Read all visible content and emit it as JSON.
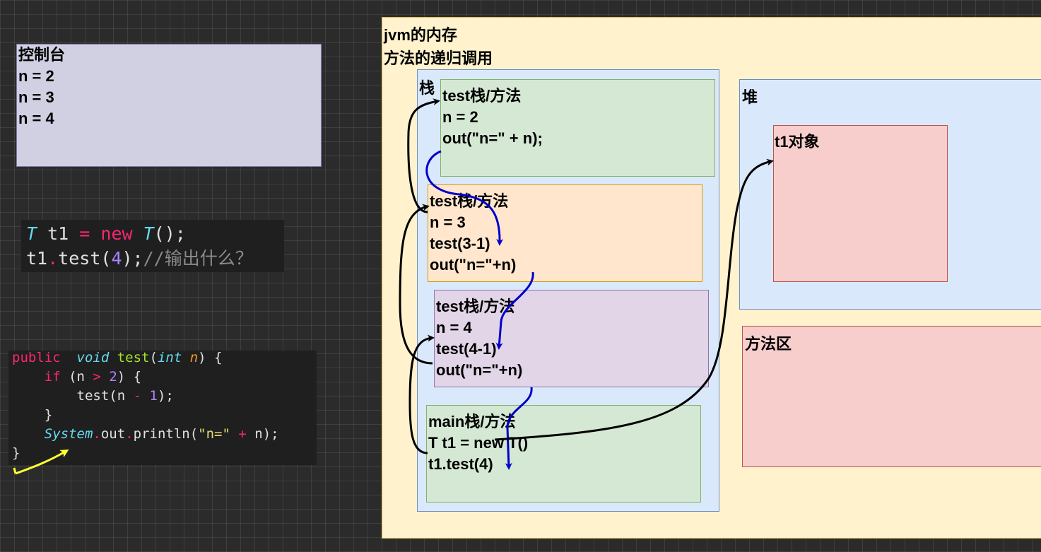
{
  "console": {
    "title": "控制台",
    "lines": [
      "n = 2",
      "n = 3",
      "n = 4"
    ]
  },
  "snippet_main": {
    "line1": {
      "type": "T",
      "var": " t1 ",
      "eq": "=",
      "kw": " new ",
      "ctor": "T",
      "rest": "();"
    },
    "line2": {
      "obj": "t1",
      "dot": ".",
      "call": "test(",
      "arg": "4",
      "end": ");",
      "comment": "//输出什么？"
    }
  },
  "snippet_method": {
    "l1": {
      "kw1": "public",
      "kw2": "  void ",
      "name": "test",
      "p1": "(",
      "ptype": "int",
      "pname": " n",
      "p2": ") {"
    },
    "l2": {
      "indent": "    ",
      "kw": "if",
      "a": " (n ",
      "op": ">",
      "b": " ",
      "num": "2",
      "c": ") {"
    },
    "l3": {
      "indent": "        ",
      "a": "test(n ",
      "op": "-",
      "b": " ",
      "num": "1",
      "c": ");"
    },
    "l4": "    }",
    "l5": {
      "indent": "    ",
      "cls": "System",
      "dot": ".",
      "a": "out",
      "dot2": ".",
      "b": "println(",
      "str": "\"n=\"",
      "op": " + ",
      "c": "n);"
    },
    "l6": "}"
  },
  "jvm": {
    "title1": "jvm的内存",
    "title2": "方法的递归调用",
    "stack_label": "栈",
    "heap_label": "堆",
    "object_label": "t1对象",
    "method_area_label": "方法区",
    "frames": [
      {
        "title": "test栈/方法",
        "lines": [
          "n = 2",
          "out(\"n=\" + n);"
        ]
      },
      {
        "title": "test栈/方法",
        "lines": [
          "n = 3",
          "test(3-1)",
          "out(\"n=\"+n)"
        ]
      },
      {
        "title": "test栈/方法",
        "lines": [
          "n = 4",
          "test(4-1)",
          "out(\"n=\"+n)"
        ]
      },
      {
        "title": "main栈/方法",
        "lines": [
          "T t1 = new T()",
          "t1.test(4)"
        ]
      }
    ]
  },
  "colors": {
    "call_arrow": "#0000cc",
    "return_arrow": "#000000",
    "highlight_arrow": "#ffff33"
  }
}
